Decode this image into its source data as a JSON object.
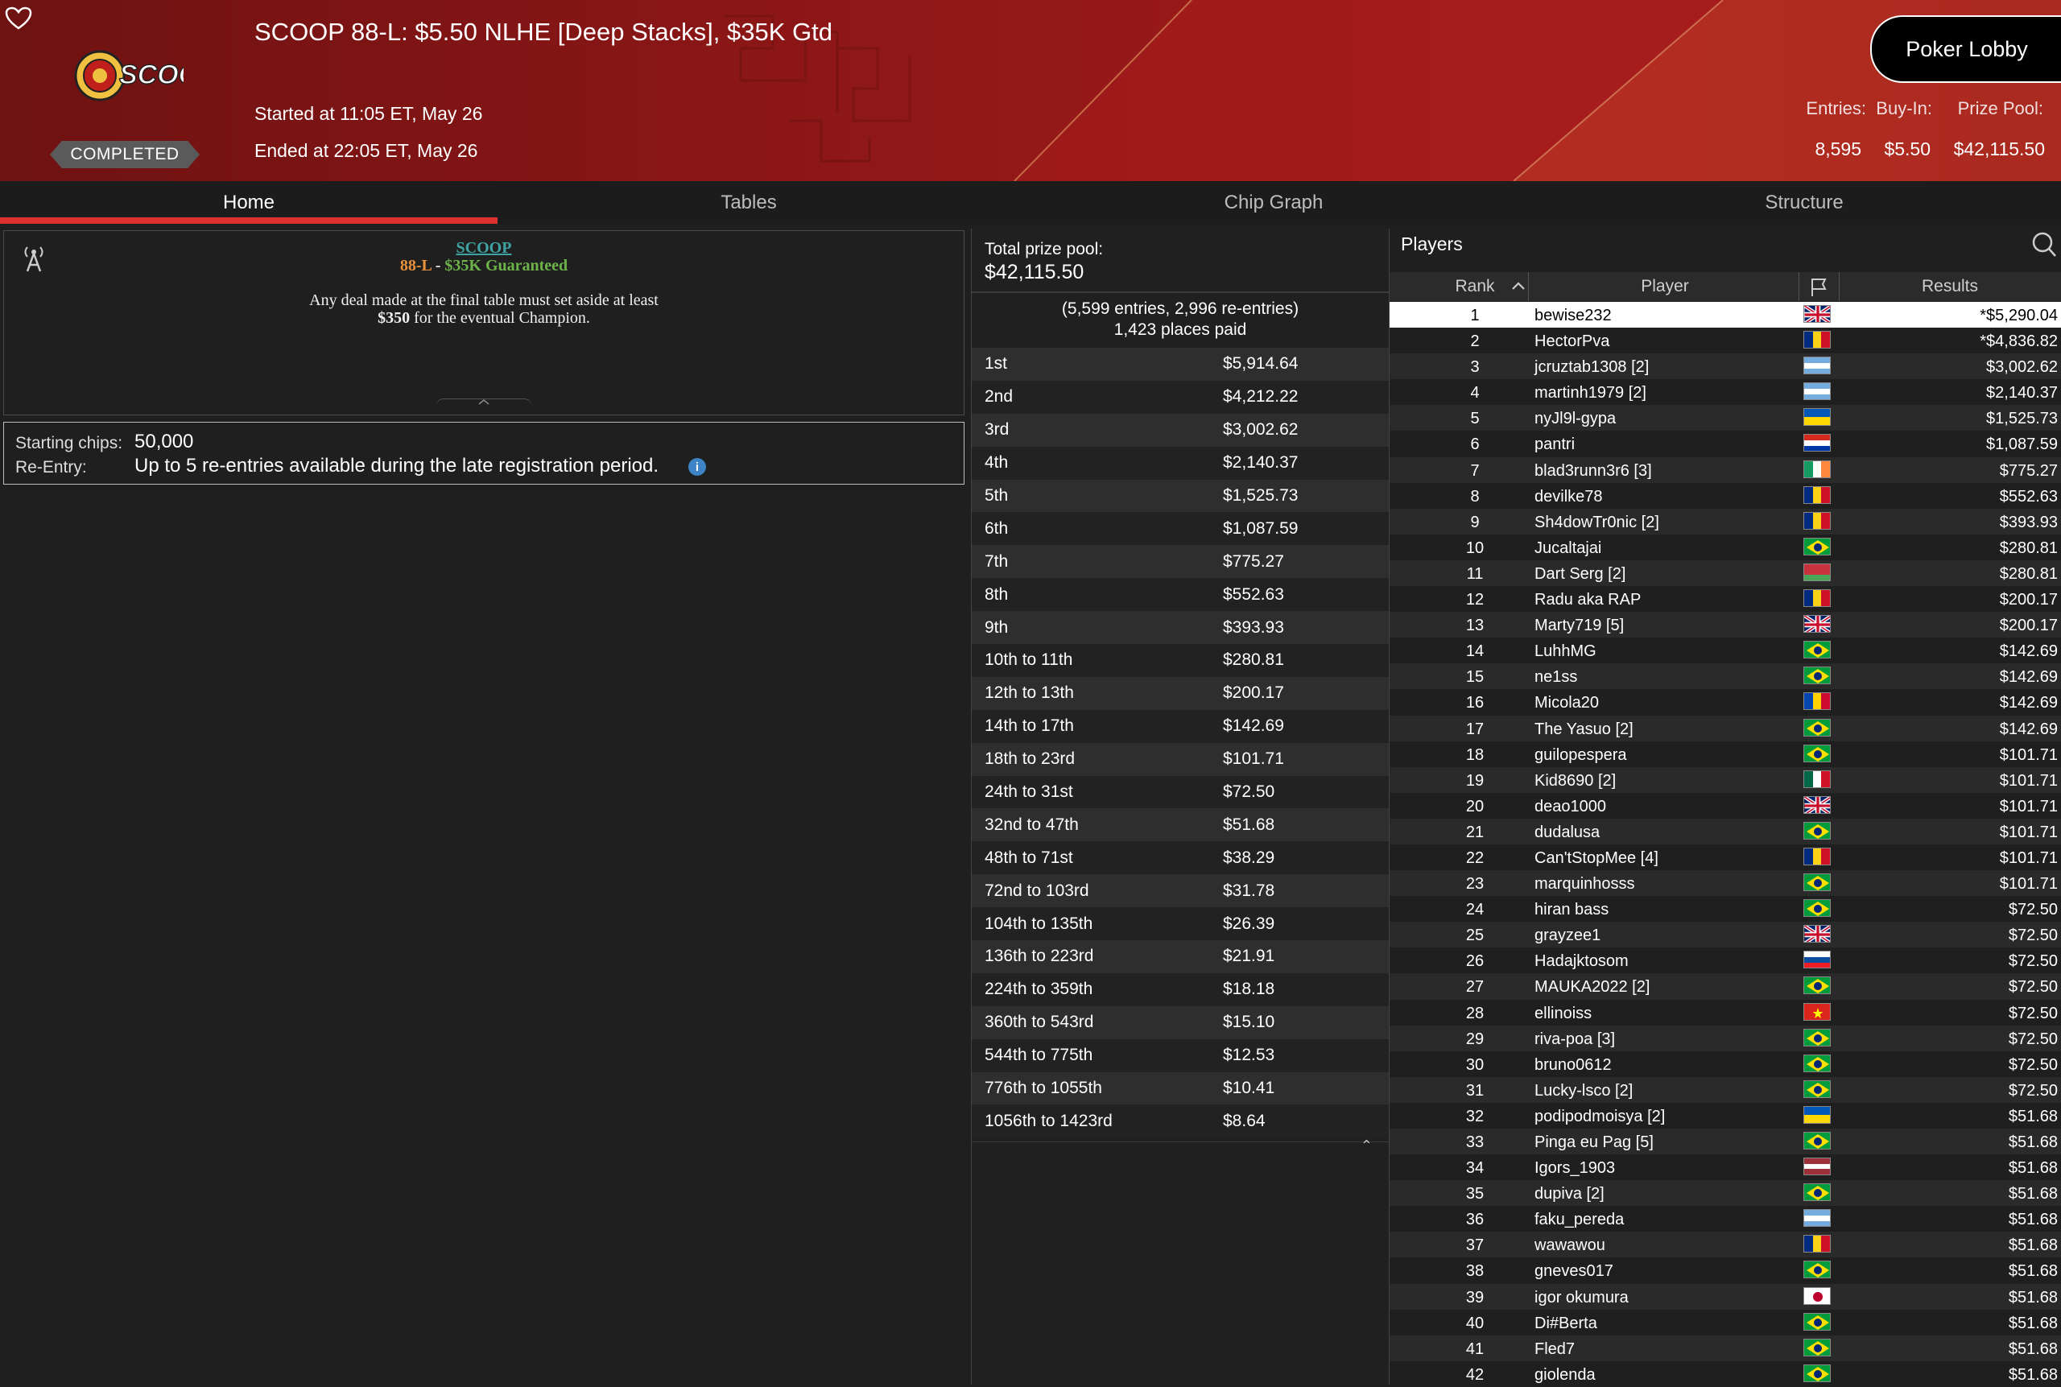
{
  "header": {
    "title": "SCOOP 88-L: $5.50 NLHE [Deep Stacks], $35K Gtd",
    "started": "Started at 11:05 ET, May 26",
    "ended": "Ended at 22:05 ET, May 26",
    "status": "COMPLETED",
    "logo_text": "SCOOP",
    "lobby_button": "Poker Lobby",
    "stats": {
      "entries_label": "Entries:",
      "buyin_label": "Buy-In:",
      "prizepool_label": "Prize Pool:",
      "entries_value": "8,595",
      "buyin_value": "$5.50",
      "prizepool_value": "$42,115.50"
    }
  },
  "tabs": [
    {
      "label": "Home",
      "active": true
    },
    {
      "label": "Tables",
      "active": false
    },
    {
      "label": "Chip Graph",
      "active": false
    },
    {
      "label": "Structure",
      "active": false
    }
  ],
  "info": {
    "scoop": "SCOOP",
    "event_code": "88-L",
    "dash": " - ",
    "guarantee": "$35K Guaranteed",
    "note_line1": "Any deal made at the final table must set aside at least",
    "note_amount": "$350",
    "note_line2_rest": " for the eventual Champion."
  },
  "chips": {
    "starting_label": "Starting chips:",
    "starting_value": "50,000",
    "reentry_label": "Re-Entry:",
    "reentry_value": "Up to 5 re-entries available during the late registration period.",
    "info_glyph": "i"
  },
  "prize": {
    "total_label": "Total prize pool:",
    "total_value": "$42,115.50",
    "entries_detail": "(5,599 entries, 2,996 re-entries)",
    "places_paid": "1,423 places paid",
    "payouts": [
      {
        "place": "1st",
        "amount": "$5,914.64"
      },
      {
        "place": "2nd",
        "amount": "$4,212.22"
      },
      {
        "place": "3rd",
        "amount": "$3,002.62"
      },
      {
        "place": "4th",
        "amount": "$2,140.37"
      },
      {
        "place": "5th",
        "amount": "$1,525.73"
      },
      {
        "place": "6th",
        "amount": "$1,087.59"
      },
      {
        "place": "7th",
        "amount": "$775.27"
      },
      {
        "place": "8th",
        "amount": "$552.63"
      },
      {
        "place": "9th",
        "amount": "$393.93"
      },
      {
        "place": "10th to 11th",
        "amount": "$280.81"
      },
      {
        "place": "12th to 13th",
        "amount": "$200.17"
      },
      {
        "place": "14th to 17th",
        "amount": "$142.69"
      },
      {
        "place": "18th to 23rd",
        "amount": "$101.71"
      },
      {
        "place": "24th to 31st",
        "amount": "$72.50"
      },
      {
        "place": "32nd to 47th",
        "amount": "$51.68"
      },
      {
        "place": "48th to 71st",
        "amount": "$38.29"
      },
      {
        "place": "72nd to 103rd",
        "amount": "$31.78"
      },
      {
        "place": "104th to 135th",
        "amount": "$26.39"
      },
      {
        "place": "136th to 223rd",
        "amount": "$21.91"
      },
      {
        "place": "224th to 359th",
        "amount": "$18.18"
      },
      {
        "place": "360th to 543rd",
        "amount": "$15.10"
      },
      {
        "place": "544th to 775th",
        "amount": "$12.53"
      },
      {
        "place": "776th to 1055th",
        "amount": "$10.41"
      },
      {
        "place": "1056th to 1423rd",
        "amount": "$8.64"
      }
    ]
  },
  "players": {
    "title": "Players",
    "columns": {
      "rank": "Rank",
      "player": "Player",
      "results": "Results"
    },
    "rows": [
      {
        "rank": "1",
        "name": "bewise232",
        "flag": "uk",
        "result": "*$5,290.04"
      },
      {
        "rank": "2",
        "name": "HectorPva",
        "flag": "romania",
        "result": "*$4,836.82"
      },
      {
        "rank": "3",
        "name": "jcruztab1308 [2]",
        "flag": "argentina",
        "result": "$3,002.62"
      },
      {
        "rank": "4",
        "name": "martinh1979 [2]",
        "flag": "argentina",
        "result": "$2,140.37"
      },
      {
        "rank": "5",
        "name": "nyJl9l-gypa",
        "flag": "ukraine",
        "result": "$1,525.73"
      },
      {
        "rank": "6",
        "name": "pantri",
        "flag": "paraguay",
        "result": "$1,087.59"
      },
      {
        "rank": "7",
        "name": "blad3runn3r6 [3]",
        "flag": "ireland",
        "result": "$775.27"
      },
      {
        "rank": "8",
        "name": "devilke78",
        "flag": "romania",
        "result": "$552.63"
      },
      {
        "rank": "9",
        "name": "Sh4dowTr0nic [2]",
        "flag": "romania",
        "result": "$393.93"
      },
      {
        "rank": "10",
        "name": "Jucaltajai",
        "flag": "brazil",
        "result": "$280.81"
      },
      {
        "rank": "11",
        "name": "Dart Serg [2]",
        "flag": "belarus",
        "result": "$280.81"
      },
      {
        "rank": "12",
        "name": "Radu aka RAP",
        "flag": "romania",
        "result": "$200.17"
      },
      {
        "rank": "13",
        "name": "Marty719 [5]",
        "flag": "uk",
        "result": "$200.17"
      },
      {
        "rank": "14",
        "name": "LuhhMG",
        "flag": "brazil",
        "result": "$142.69"
      },
      {
        "rank": "15",
        "name": "ne1ss",
        "flag": "brazil",
        "result": "$142.69"
      },
      {
        "rank": "16",
        "name": "Micola20",
        "flag": "moldova",
        "result": "$142.69"
      },
      {
        "rank": "17",
        "name": "The Yasuo [2]",
        "flag": "brazil",
        "result": "$142.69"
      },
      {
        "rank": "18",
        "name": "guilopespera",
        "flag": "brazil",
        "result": "$101.71"
      },
      {
        "rank": "19",
        "name": "Kid8690 [2]",
        "flag": "mexico",
        "result": "$101.71"
      },
      {
        "rank": "20",
        "name": "deao1000",
        "flag": "uk",
        "result": "$101.71"
      },
      {
        "rank": "21",
        "name": "dudalusa",
        "flag": "brazil",
        "result": "$101.71"
      },
      {
        "rank": "22",
        "name": "Can'tStopMee [4]",
        "flag": "romania",
        "result": "$101.71"
      },
      {
        "rank": "23",
        "name": "marquinhosss",
        "flag": "brazil",
        "result": "$101.71"
      },
      {
        "rank": "24",
        "name": "hiran bass",
        "flag": "brazil",
        "result": "$72.50"
      },
      {
        "rank": "25",
        "name": "grayzee1",
        "flag": "uk",
        "result": "$72.50"
      },
      {
        "rank": "26",
        "name": "Hadajktosom",
        "flag": "slovakia",
        "result": "$72.50"
      },
      {
        "rank": "27",
        "name": "MAUKA2022 [2]",
        "flag": "brazil",
        "result": "$72.50"
      },
      {
        "rank": "28",
        "name": "ellinoiss",
        "flag": "vietnam",
        "result": "$72.50"
      },
      {
        "rank": "29",
        "name": "riva-poa [3]",
        "flag": "brazil",
        "result": "$72.50"
      },
      {
        "rank": "30",
        "name": "bruno0612",
        "flag": "brazil",
        "result": "$72.50"
      },
      {
        "rank": "31",
        "name": "Lucky-lsco [2]",
        "flag": "brazil",
        "result": "$72.50"
      },
      {
        "rank": "32",
        "name": "podipodmoisya [2]",
        "flag": "ukraine",
        "result": "$51.68"
      },
      {
        "rank": "33",
        "name": "Pinga eu Pag [5]",
        "flag": "brazil",
        "result": "$51.68"
      },
      {
        "rank": "34",
        "name": "Igors_1903",
        "flag": "latvia",
        "result": "$51.68"
      },
      {
        "rank": "35",
        "name": "dupiva [2]",
        "flag": "brazil",
        "result": "$51.68"
      },
      {
        "rank": "36",
        "name": "faku_pereda",
        "flag": "argentina",
        "result": "$51.68"
      },
      {
        "rank": "37",
        "name": "wawawou",
        "flag": "romania",
        "result": "$51.68"
      },
      {
        "rank": "38",
        "name": "gneves017",
        "flag": "brazil",
        "result": "$51.68"
      },
      {
        "rank": "39",
        "name": "igor okumura",
        "flag": "japan",
        "result": "$51.68"
      },
      {
        "rank": "40",
        "name": "Di#Berta",
        "flag": "brazil",
        "result": "$51.68"
      },
      {
        "rank": "41",
        "name": "Fled7",
        "flag": "brazil",
        "result": "$51.68"
      },
      {
        "rank": "42",
        "name": "giolenda",
        "flag": "brazil",
        "result": "$51.68"
      }
    ]
  }
}
